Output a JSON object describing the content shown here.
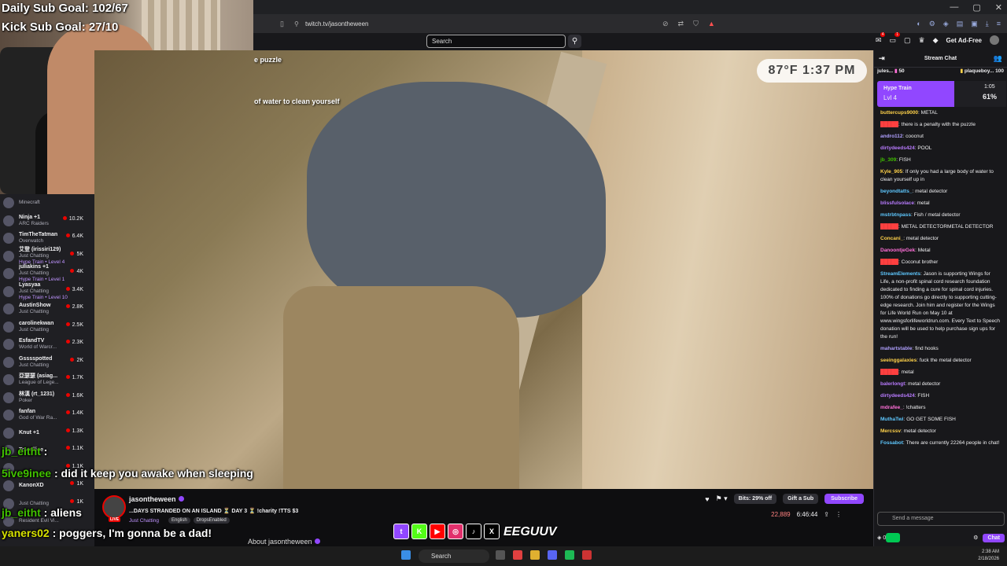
{
  "overlay": {
    "daily_goal": "Daily Sub Goal: 102/67",
    "kick_goal": "Kick Sub Goal: 27/10",
    "weather": "87°F 1:37 PM",
    "video_text_1": "e puzzle",
    "video_text_2": "of water to clean yourself",
    "brand": "EEGUUV"
  },
  "browser": {
    "url": "twitch.tv/jasontheween",
    "search_placeholder": "Search",
    "get_ad_free": "Get Ad-Free",
    "notif_count_1": "4",
    "notif_count_2": "1"
  },
  "sidebar": {
    "items": [
      {
        "name": "",
        "game": "Minecraft",
        "hype": "",
        "viewers": ""
      },
      {
        "name": "Ninja +1",
        "game": "ARC Raiders",
        "hype": "",
        "viewers": "10.2K"
      },
      {
        "name": "TimTheTatman",
        "game": "Overwatch",
        "hype": "",
        "viewers": "6.4K"
      },
      {
        "name": "艾登 (irissiri129)",
        "game": "Just Chatting",
        "hype": "Hype Train • Level 4",
        "viewers": "5K"
      },
      {
        "name": "juliakins +1",
        "game": "Just Chatting",
        "hype": "Hype Train • Level 1",
        "viewers": "4K"
      },
      {
        "name": "Lyasyaa",
        "game": "Just Chatting",
        "hype": "Hype Train • Level 10",
        "viewers": "3.4K"
      },
      {
        "name": "AustinShow",
        "game": "Just Chatting",
        "hype": "",
        "viewers": "2.8K"
      },
      {
        "name": "carolinekwan",
        "game": "Just Chatting",
        "hype": "",
        "viewers": "2.5K"
      },
      {
        "name": "EsfandTV",
        "game": "World of Warcr...",
        "hype": "",
        "viewers": "2.3K"
      },
      {
        "name": "Gsssspotted",
        "game": "Just Chatting",
        "hype": "",
        "viewers": "2K"
      },
      {
        "name": "亞瑟瑟 (asiag...",
        "game": "League of Lege...",
        "hype": "",
        "viewers": "1.7K"
      },
      {
        "name": "林漢 (rt_1231)",
        "game": "Poker",
        "hype": "",
        "viewers": "1.6K"
      },
      {
        "name": "fanfan",
        "game": "God of War Ra...",
        "hype": "",
        "viewers": "1.4K"
      },
      {
        "name": "Knut +1",
        "game": "",
        "hype": "",
        "viewers": "1.3K"
      },
      {
        "name": "Towelliee",
        "game": "",
        "hype": "",
        "viewers": "1.1K"
      },
      {
        "name": "",
        "game": "",
        "hype": "",
        "viewers": "1.1K"
      },
      {
        "name": "KanonXD",
        "game": "",
        "hype": "",
        "viewers": "1K"
      },
      {
        "name": "",
        "game": "Just Chatting",
        "hype": "",
        "viewers": "1K"
      },
      {
        "name": "",
        "game": "Resident Evil Vi...",
        "hype": "",
        "viewers": ""
      }
    ]
  },
  "overlay_chat": [
    {
      "user": "jb_eitht",
      "text": ""
    },
    {
      "user": "5ive9inee",
      "text": "did it keep you awake when sleeping"
    },
    {
      "user": "jb_eitht",
      "text": "aliens"
    },
    {
      "user": "yaners02",
      "text": "poggers, I'm gonna be a dad!"
    },
    {
      "user": "Kranzn",
      "text": ""
    }
  ],
  "stream": {
    "channel": "jasontheween",
    "title": "...DAYS STRANDED ON AN ISLAND ⏳ DAY 3 ⏳ !charity !TTS $3",
    "category": "Just Chatting",
    "tags": [
      "English",
      "DropsEnabled"
    ],
    "live": "LIVE",
    "bits": "Bits: 29% off",
    "gift": "Gift a Sub",
    "subscribe": "Subscribe",
    "viewers": "22,889",
    "uptime": "6:46:44",
    "about": "About jasontheween"
  },
  "chat": {
    "header": "Stream Chat",
    "gift_left": "jules...",
    "gift_left_count": "50",
    "gift_right": "plaqueboy...",
    "gift_right_count": "100",
    "hype_title": "Hype Train",
    "hype_level": "Lvl 4",
    "hype_time": "1:05",
    "hype_pct": "61%",
    "messages": [
      {
        "user": "buttercups9000",
        "color": "#ffd24a",
        "text": "METAL"
      },
      {
        "user": "",
        "color": "#ff4040",
        "text": "there is a penalty with the puzzle"
      },
      {
        "user": "andro112",
        "color": "#b0a0ff",
        "text": "coocnut"
      },
      {
        "user": "dirtydeeds424",
        "color": "#b97bff",
        "text": "POOL"
      },
      {
        "user": "jb_309",
        "color": "#41c000",
        "text": "FISH"
      },
      {
        "user": "Kyle_905",
        "color": "#ffd24a",
        "text": "If only you had a large body of water to clean yourself up in"
      },
      {
        "user": "beyondtatts_",
        "color": "#5ec8ff",
        "text": "metal detector"
      },
      {
        "user": "blissfulsolace",
        "color": "#b97bff",
        "text": "metal"
      },
      {
        "user": "mstrbtnpass",
        "color": "#5ec8ff",
        "text": "Fish / metal detector"
      },
      {
        "user": "",
        "color": "#ff4040",
        "text": "METAL DETECTORMETAL DETECTOR"
      },
      {
        "user": "Concani_",
        "color": "#ffd24a",
        "text": "metal detector"
      },
      {
        "user": "DanoontjeGek",
        "color": "#ff6fd8",
        "text": "Metal"
      },
      {
        "user": "",
        "color": "#ff4040",
        "text": "Coconut brother"
      },
      {
        "user": "StreamElements",
        "color": "#5ec8ff",
        "text": "Jason is supporting Wings for Life, a non-profit spinal cord research foundation dedicated to finding a cure for spinal cord injuries. 100% of donations go directly to supporting cutting-edge research. Join him and register for the Wings for Life World Run on May 10 at www.wingsforlifeworldrun.com. Every Text to Speech donation will be used to help purchase sign ups for the run!"
      },
      {
        "user": "mahartstable",
        "color": "#b0a0ff",
        "text": "find hooks"
      },
      {
        "user": "seeinggalaxies",
        "color": "#ffd24a",
        "text": "fuck the metal detector"
      },
      {
        "user": "",
        "color": "#ff4040",
        "text": "metal"
      },
      {
        "user": "balerlongt",
        "color": "#b97bff",
        "text": "metal detector"
      },
      {
        "user": "dirtydeeds424",
        "color": "#b97bff",
        "text": "FISH"
      },
      {
        "user": "mdrafee_",
        "color": "#ff6fd8",
        "text": "!chatters"
      },
      {
        "user": "MuthaTwi",
        "color": "#5ec8ff",
        "text": "GO GET SOME FISH"
      },
      {
        "user": "Mercssv",
        "color": "#ffd24a",
        "text": "metal detector"
      },
      {
        "user": "Fossabot",
        "color": "#5ec8ff",
        "text": "There are currently 22264 people in chat!"
      }
    ],
    "send_placeholder": "Send a message",
    "points": "0",
    "chat_button": "Chat"
  },
  "taskbar": {
    "search": "Search",
    "time": "2:38 AM",
    "date": "2/18/2026"
  },
  "socials": [
    "t",
    "K",
    "▶",
    "◎",
    "♪",
    "X"
  ]
}
